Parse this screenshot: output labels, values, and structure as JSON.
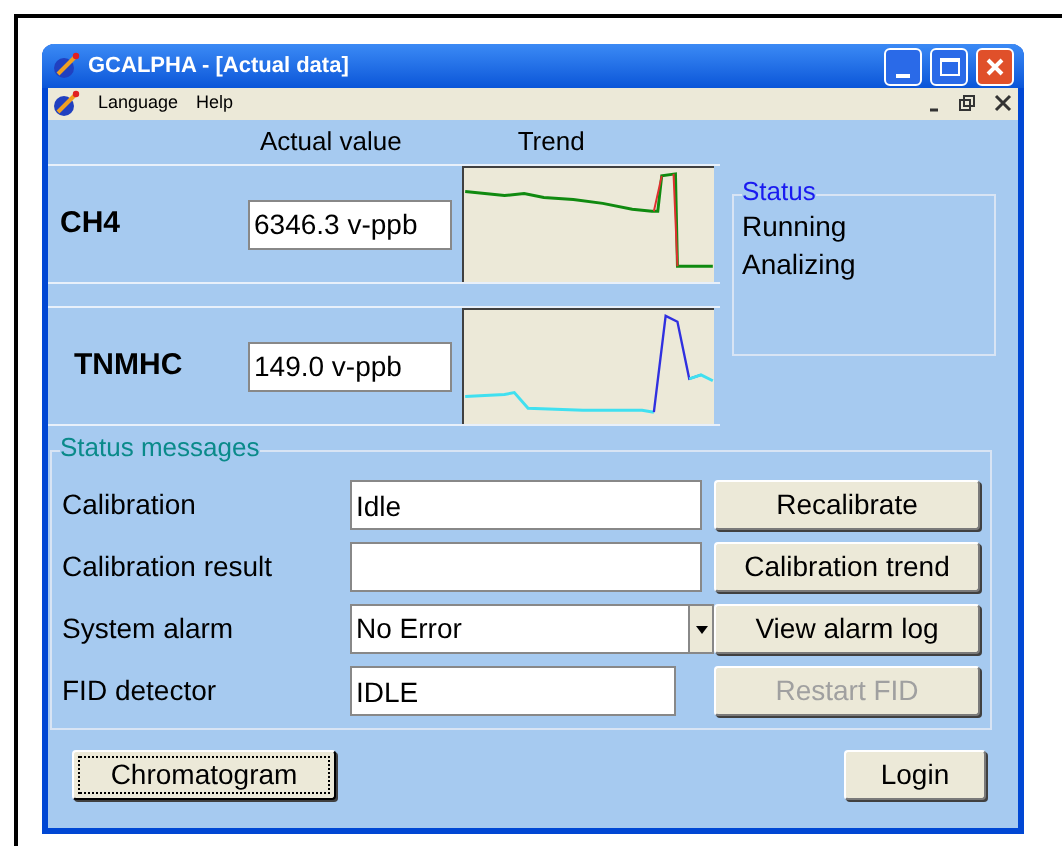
{
  "window": {
    "title": "GCALPHA - [Actual data]"
  },
  "menu": [
    {
      "label": "Language"
    },
    {
      "label": "Help"
    }
  ],
  "headings": [
    "Actual value",
    "Trend"
  ],
  "measurements": [
    {
      "name": "CH4",
      "value": "6346.3 v-ppb"
    },
    {
      "name": "TNMHC",
      "value": "149.0 v-ppb"
    }
  ],
  "status": {
    "title": "Status",
    "lines": [
      "Running",
      "Analizing"
    ]
  },
  "status_messages": {
    "title": "Status messages",
    "rows": [
      {
        "label": "Calibration",
        "value": "Idle",
        "kind": "field",
        "button": {
          "label": "Recalibrate",
          "disabled": false
        }
      },
      {
        "label": "Calibration result",
        "kind": "field",
        "button": {
          "label": "Calibration trend",
          "disabled": false
        }
      },
      {
        "label": "System alarm",
        "value": "No Error",
        "kind": "dropdown",
        "button": {
          "label": "View alarm log",
          "disabled": false
        }
      },
      {
        "label": "FID detector",
        "value": "IDLE",
        "kind": "short-field",
        "button": {
          "label": "Restart FID",
          "disabled": true
        }
      }
    ]
  },
  "buttons": [
    {
      "label": "Chromatogram",
      "focused": true
    },
    {
      "label": "Login",
      "focused": false
    }
  ]
}
